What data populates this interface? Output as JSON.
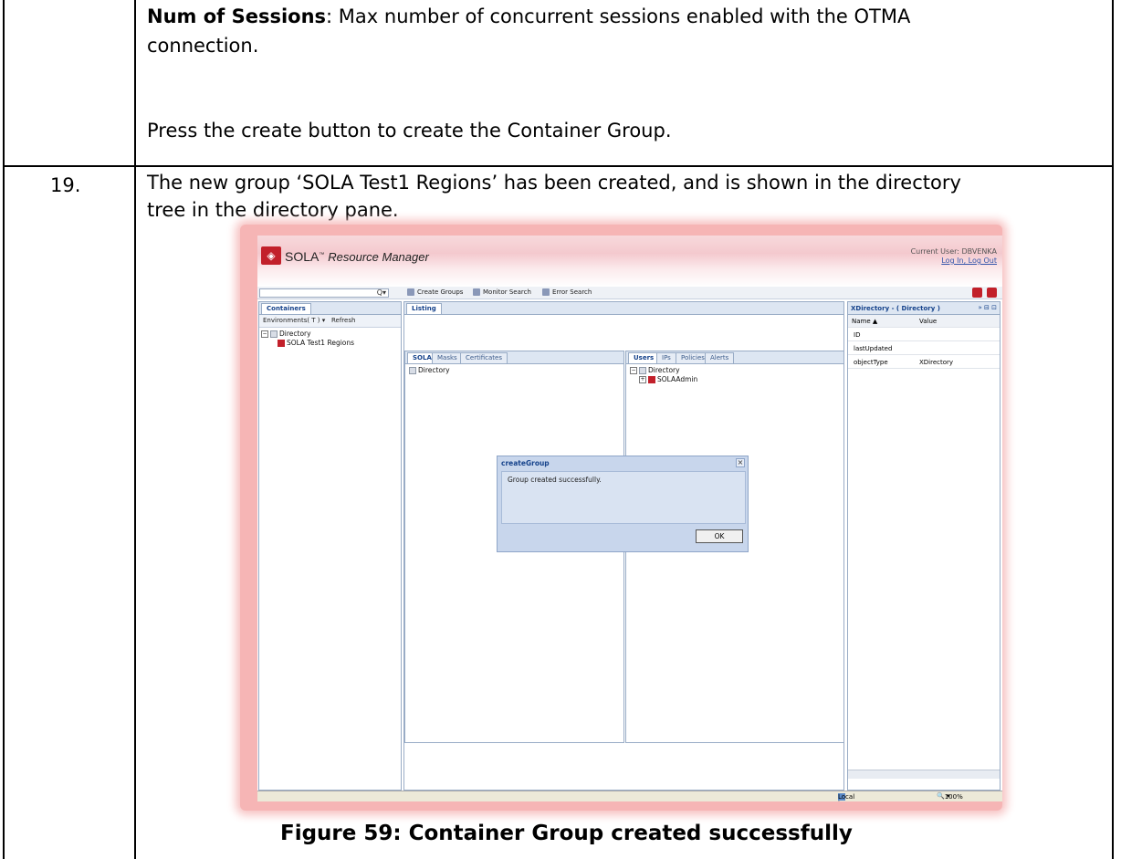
{
  "row1": {
    "bold_term": "Num of Sessions",
    "line1_rest": ": Max number of concurrent sessions enabled with the OTMA",
    "line2": "connection.",
    "line3": "Press the create button to create the Container Group."
  },
  "row2": {
    "step_number": "19.",
    "line1": "The new group ‘SOLA Test1 Regions’ has been created, and is shown in the directory",
    "line2": "tree in the directory pane."
  },
  "caption": "Figure 59: Container Group created successfully",
  "screenshot": {
    "brand": "SOLA",
    "tm": "™",
    "app_subtitle": "Resource Manager",
    "current_user_label": "Current User: DBVENKA",
    "user_links": "Log In, Log Out",
    "search_icon": "Q▾",
    "toolbar": {
      "create_groups": "Create Groups",
      "monitor_search": "Monitor Search",
      "error_search": "Error Search"
    },
    "left_pane": {
      "tab": "Containers",
      "environments": "Environments( T )",
      "refresh": "Refresh",
      "tree": [
        "Directory",
        "SOLA Test1 Regions"
      ]
    },
    "listing_tab": "Listing",
    "center_left": {
      "tabs": [
        "SOLA",
        "Masks",
        "Certificates"
      ],
      "tree": [
        "Directory"
      ]
    },
    "center_right": {
      "tabs": [
        "Users",
        "IPs",
        "Policies",
        "Alerts"
      ],
      "tree": [
        "Directory",
        "SOLAAdmin"
      ]
    },
    "right_pane": {
      "title": "XDirectory - ( Directory )",
      "col_name": "Name ▲",
      "col_value": "Value",
      "rows": [
        {
          "name": "ID",
          "value": ""
        },
        {
          "name": "lastUpdated",
          "value": ""
        },
        {
          "name": "objectType",
          "value": "XDirectory"
        }
      ]
    },
    "dialog": {
      "title": "createGroup",
      "close": "×",
      "message": "Group created successfully.",
      "ok": "OK"
    },
    "status": {
      "zone": "Local intranet",
      "zoom": "100%"
    }
  }
}
